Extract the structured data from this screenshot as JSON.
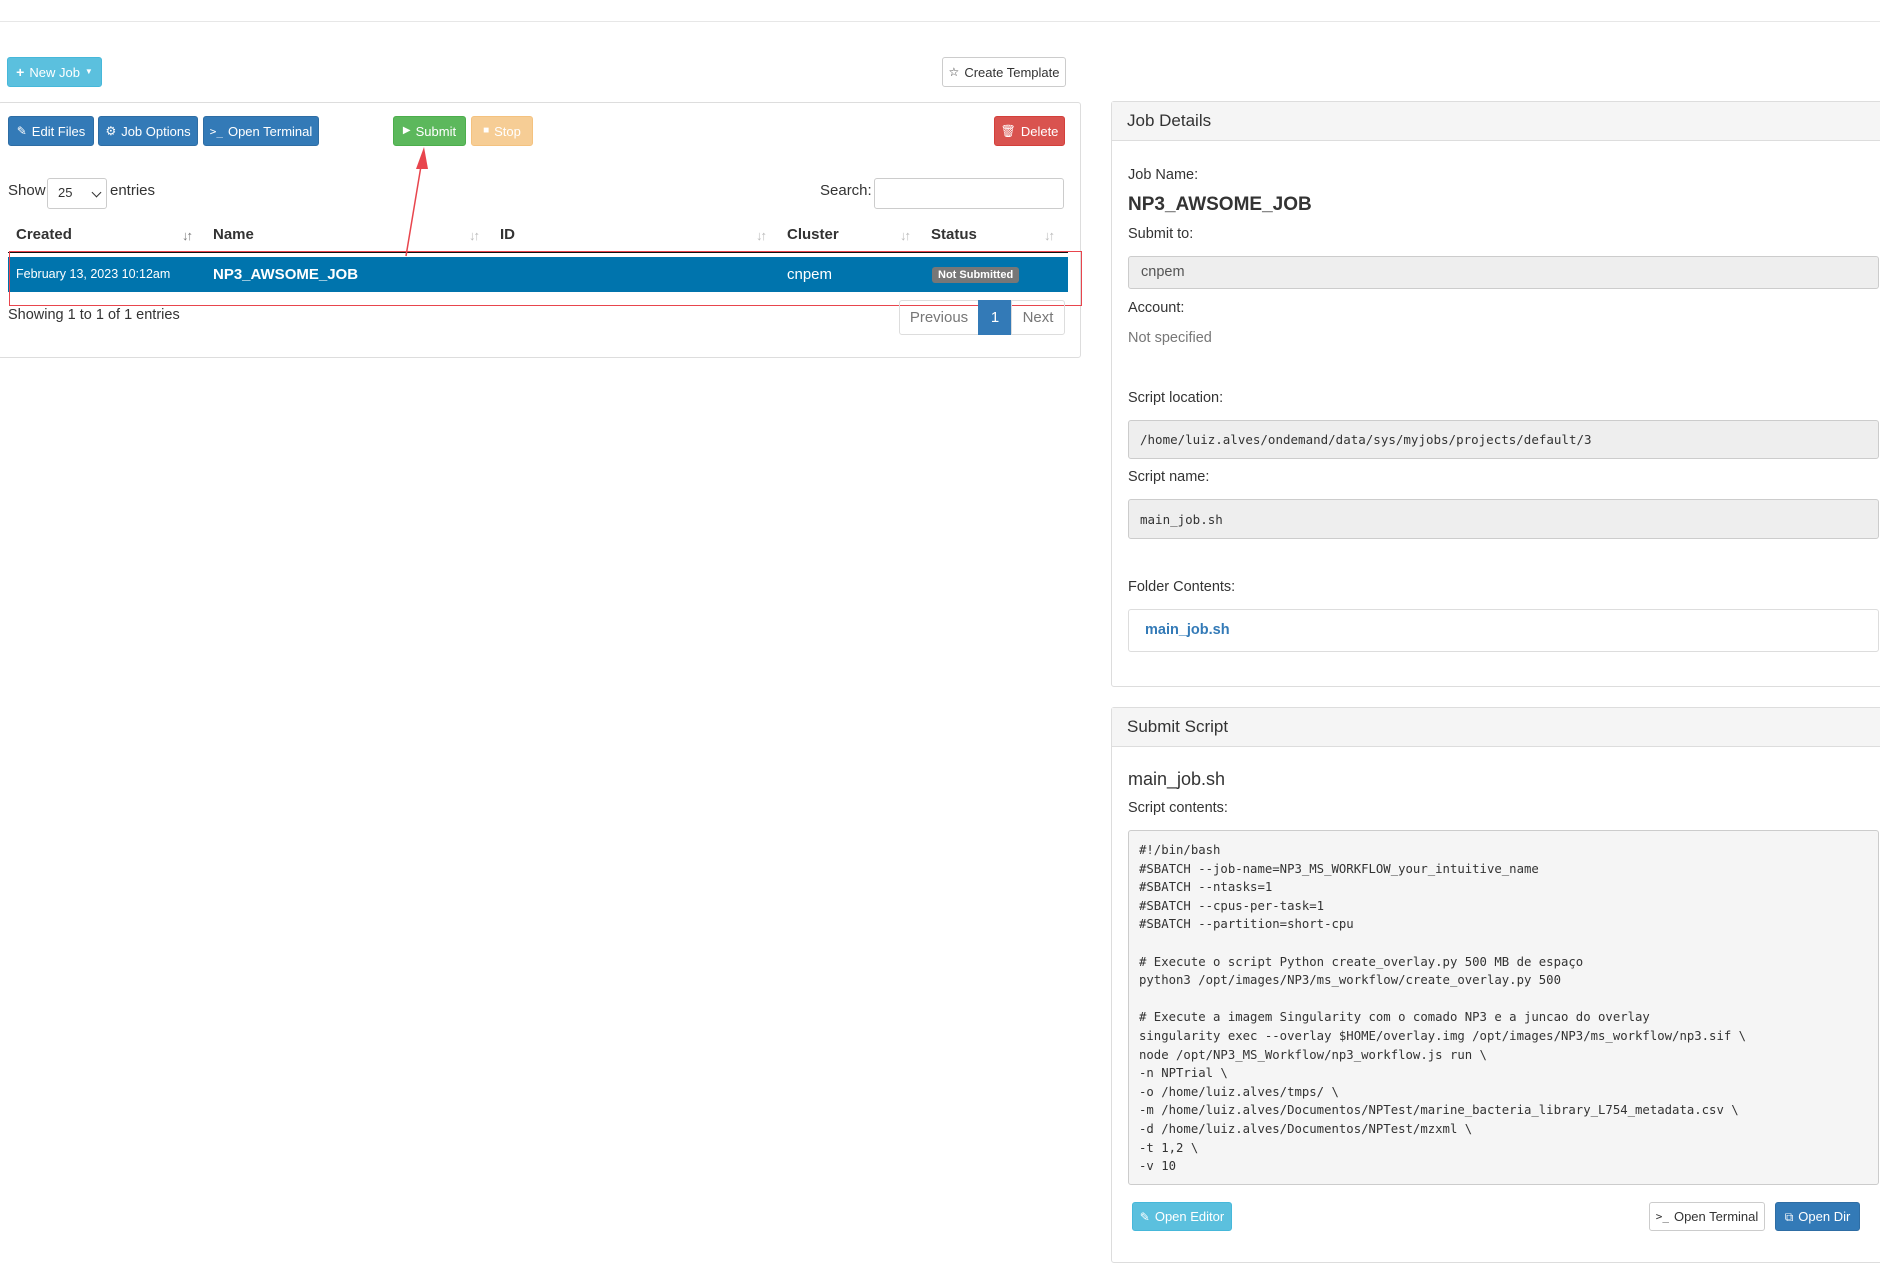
{
  "toolbar": {
    "new_job": "New Job",
    "create_template": "Create Template"
  },
  "actions": {
    "edit_files": "Edit Files",
    "job_options": "Job Options",
    "open_terminal": "Open Terminal",
    "submit": "Submit",
    "stop": "Stop",
    "delete": "Delete"
  },
  "table_controls": {
    "show": "Show",
    "page_size": "25",
    "entries": "entries",
    "search": "Search:"
  },
  "table": {
    "columns": [
      "Created",
      "Name",
      "ID",
      "Cluster",
      "Status"
    ],
    "rows": [
      {
        "created": "February 13, 2023 10:12am",
        "name": "NP3_AWSOME_JOB",
        "id": "",
        "cluster": "cnpem",
        "status": "Not Submitted"
      }
    ],
    "info": "Showing 1 to 1 of 1 entries",
    "pager": {
      "previous": "Previous",
      "current": "1",
      "next": "Next"
    }
  },
  "job_details": {
    "heading": "Job Details",
    "job_name_label": "Job Name:",
    "job_name": "NP3_AWSOME_JOB",
    "submit_to_label": "Submit to:",
    "submit_to": "cnpem",
    "account_label": "Account:",
    "account": "Not specified",
    "script_location_label": "Script location:",
    "script_location": "/home/luiz.alves/ondemand/data/sys/myjobs/projects/default/3",
    "script_name_label": "Script name:",
    "script_name": "main_job.sh",
    "folder_contents_label": "Folder Contents:",
    "folder_file": "main_job.sh"
  },
  "submit_script": {
    "heading": "Submit Script",
    "file_name": "main_job.sh",
    "contents_label": "Script contents:",
    "contents": "#!/bin/bash\n#SBATCH --job-name=NP3_MS_WORKFLOW_your_intuitive_name\n#SBATCH --ntasks=1\n#SBATCH --cpus-per-task=1\n#SBATCH --partition=short-cpu\n\n# Execute o script Python create_overlay.py 500 MB de espaço\npython3 /opt/images/NP3/ms_workflow/create_overlay.py 500\n\n# Execute a imagem Singularity com o comado NP3 e a juncao do overlay\nsingularity exec --overlay $HOME/overlay.img /opt/images/NP3/ms_workflow/np3.sif \\\nnode /opt/NP3_MS_Workflow/np3_workflow.js run \\\n-n NPTrial \\\n-o /home/luiz.alves/tmps/ \\\n-m /home/luiz.alves/Documentos/NPTest/marine_bacteria_library_L754_metadata.csv \\\n-d /home/luiz.alves/Documentos/NPTest/mzxml \\\n-t 1,2 \\\n-v 10",
    "open_editor": "Open Editor",
    "open_terminal": "Open Terminal",
    "open_dir": "Open Dir"
  },
  "annotation_color": "#e8454d"
}
